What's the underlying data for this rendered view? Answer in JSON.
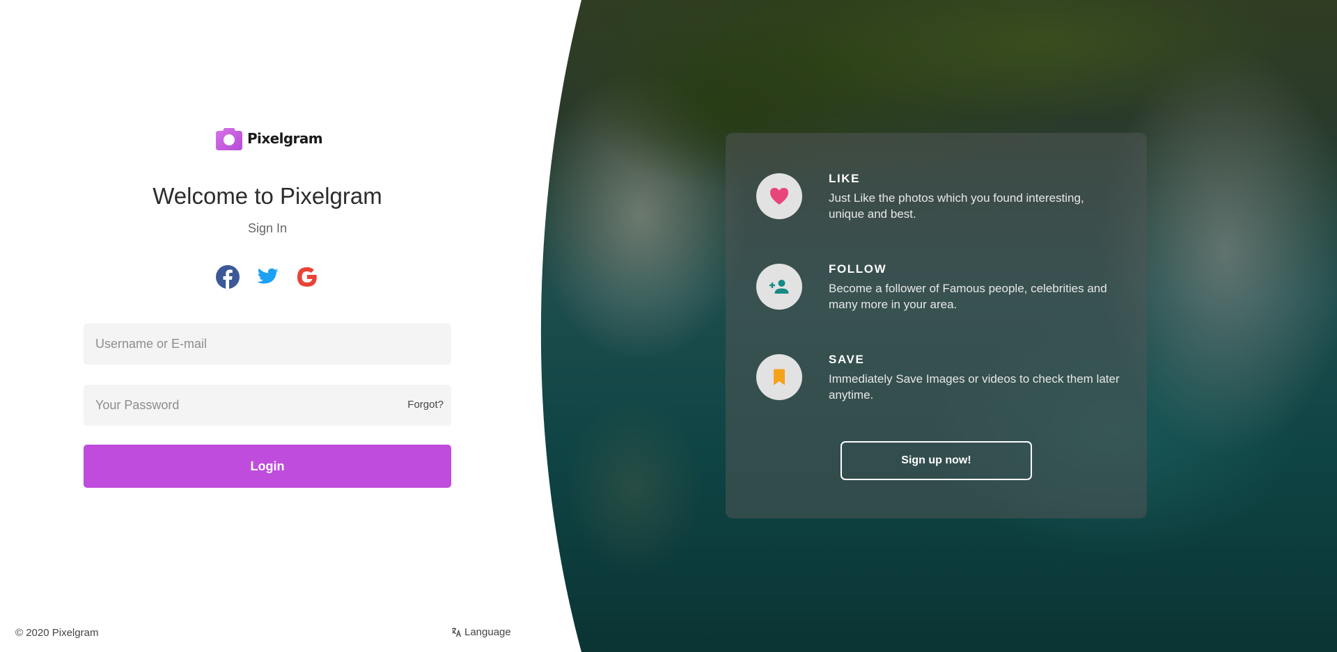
{
  "brand": {
    "name": "Pixelgram",
    "icon": "camera-icon",
    "accent": "#bf4cdc"
  },
  "login": {
    "welcome": "Welcome to Pixelgram",
    "subtitle": "Sign In",
    "socials": [
      {
        "name": "facebook-icon",
        "color": "#3b5998"
      },
      {
        "name": "twitter-icon",
        "color": "#1da1f2"
      },
      {
        "name": "google-icon",
        "color": "#ea4335"
      }
    ],
    "username_placeholder": "Username or E-mail",
    "password_placeholder": "Your Password",
    "forgot_label": "Forgot?",
    "login_label": "Login"
  },
  "footer": {
    "copyright": "© 2020 Pixelgram",
    "language_label": "Language",
    "language_icon": "translate-icon"
  },
  "features": [
    {
      "title": "LIKE",
      "description": "Just Like the photos which you found interesting, unique and best.",
      "icon": "heart-icon",
      "color": "#e8457a"
    },
    {
      "title": "FOLLOW",
      "description": "Become a follower of Famous people, celebrities and many more in your area.",
      "icon": "add-person-icon",
      "color": "#138a84"
    },
    {
      "title": "SAVE",
      "description": "Immediately Save Images or videos to check them later anytime.",
      "icon": "bookmark-icon",
      "color": "#f5a21a"
    }
  ],
  "signup_label": "Sign up now!"
}
